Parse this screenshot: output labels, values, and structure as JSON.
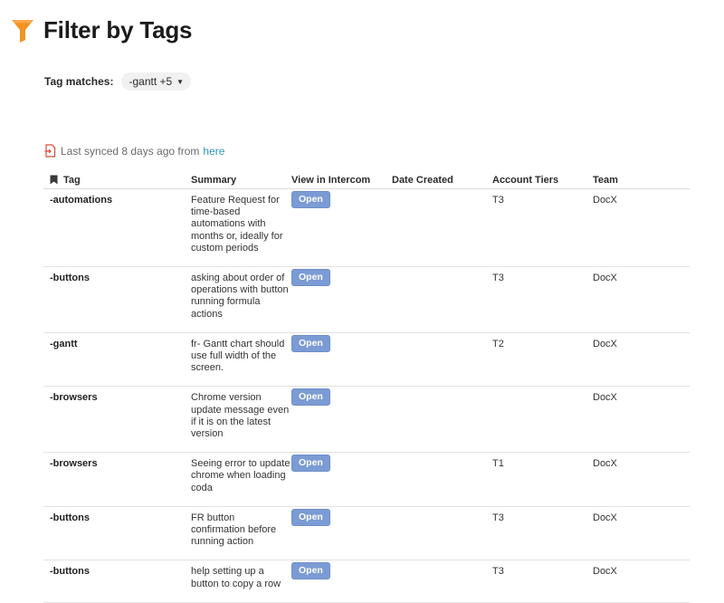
{
  "page": {
    "title": "Filter by Tags"
  },
  "filter": {
    "label": "Tag matches:",
    "chip": "-gantt +5"
  },
  "sync": {
    "text": "Last synced 8 days ago from",
    "link": "here"
  },
  "table": {
    "columns": [
      "Tag",
      "Summary",
      "View in Intercom",
      "Date Created",
      "Account Tiers",
      "Team"
    ],
    "rows": [
      {
        "tag": "-automations",
        "summary": "Feature Request for time-based automations with months or, ideally for custom periods",
        "view": "Open",
        "date": "",
        "tier": "T3",
        "team": "DocX"
      },
      {
        "tag": "-buttons",
        "summary": "asking about order of operations with button running formula actions",
        "view": "Open",
        "date": "",
        "tier": "T3",
        "team": "DocX"
      },
      {
        "tag": "-gantt",
        "summary": " fr- Gantt chart should use full width of the screen.",
        "view": "Open",
        "date": "",
        "tier": "T2",
        "team": "DocX"
      },
      {
        "tag": "-browsers",
        "summary": "Chrome version update message even if it is on the latest version",
        "view": "Open",
        "date": "",
        "tier": "",
        "team": "DocX"
      },
      {
        "tag": "-browsers",
        "summary": "Seeing error to update chrome when loading coda",
        "view": "Open",
        "date": "",
        "tier": "T1",
        "team": "DocX"
      },
      {
        "tag": "-buttons",
        "summary": " FR button confirmation before running action",
        "view": "Open",
        "date": "",
        "tier": " T3",
        "team": "DocX"
      },
      {
        "tag": "-buttons",
        "summary": "help setting up a button to copy a row",
        "view": "Open",
        "date": "",
        "tier": "T3",
        "team": "DocX"
      }
    ]
  }
}
